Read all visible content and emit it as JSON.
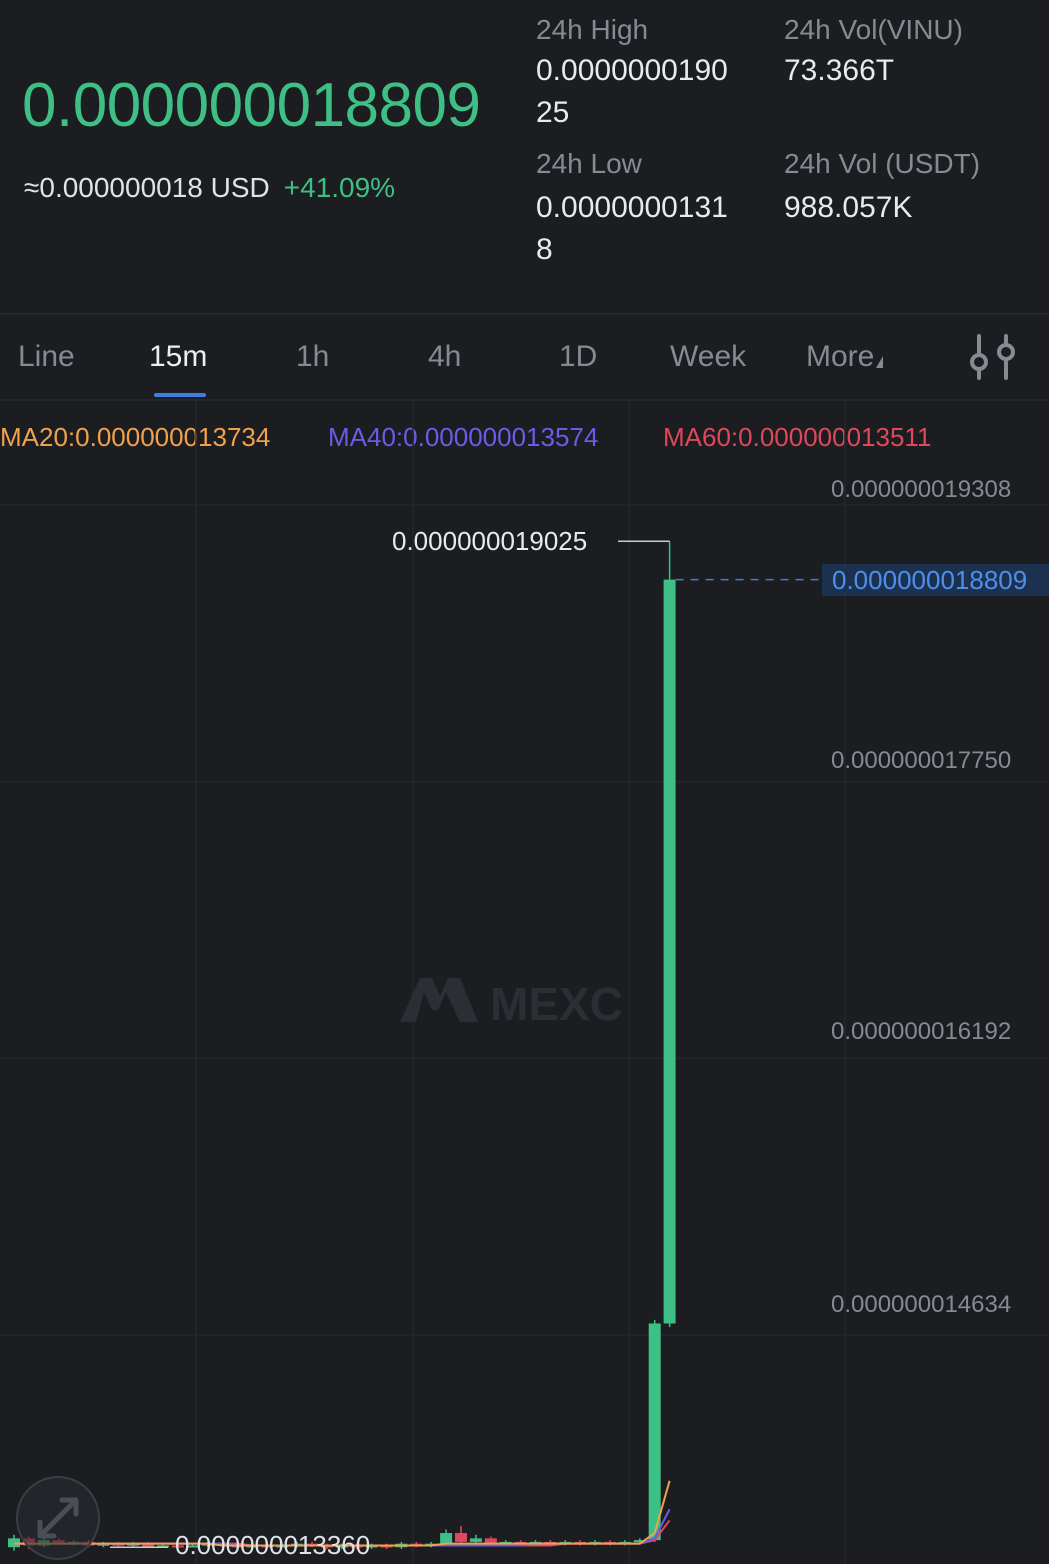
{
  "ticker": {
    "price": "0.000000018809",
    "usd_approx": "≈0.000000018 USD",
    "change_pct": "+41.09%",
    "high_label": "24h High",
    "high_value_line1": "0.0000000190",
    "high_value_line2": "25",
    "low_label": "24h Low",
    "low_value_line1": "0.0000000131",
    "low_value_line2": "8",
    "vol_base_label": "24h Vol(VINU)",
    "vol_base_value": "73.366T",
    "vol_quote_label": "24h Vol (USDT)",
    "vol_quote_value": "988.057K"
  },
  "tabs": [
    {
      "label": "Line",
      "active": false
    },
    {
      "label": "15m",
      "active": true
    },
    {
      "label": "1h",
      "active": false
    },
    {
      "label": "4h",
      "active": false
    },
    {
      "label": "1D",
      "active": false
    },
    {
      "label": "Week",
      "active": false
    },
    {
      "label": "More",
      "active": false
    }
  ],
  "indicators": {
    "ma20": "MA20:0.000000013734",
    "ma40": "MA40:0.000000013574",
    "ma60": "MA60:0.000000013511"
  },
  "colors": {
    "up": "#3ebf86",
    "down": "#e0475c",
    "ma20": "#f0a24a",
    "ma40": "#6a5ce8",
    "ma60": "#e0475c",
    "accent": "#3f7ee0"
  },
  "watermark": "MEXC",
  "chart_data": {
    "type": "candlestick",
    "interval": "15m",
    "y_axis_labels": [
      "0.000000019308",
      "0.000000017750",
      "0.000000016192",
      "0.000000014634"
    ],
    "y_axis_values": [
      1.9308e-08,
      1.775e-08,
      1.6192e-08,
      1.4634e-08
    ],
    "last_price_label": "0.000000018809",
    "last_price": 1.8809e-08,
    "high_marker_label": "0.000000019025",
    "high_marker": 1.9025e-08,
    "low_marker_label": "0.000000013360",
    "low_marker": 1.336e-08,
    "candles": [
      {
        "open": 1.336e-08,
        "close": 1.341e-08,
        "high": 1.343e-08,
        "low": 1.334e-08
      },
      {
        "open": 1.341e-08,
        "close": 1.337e-08,
        "high": 1.342e-08,
        "low": 1.335e-08
      },
      {
        "open": 1.337e-08,
        "close": 1.34e-08,
        "high": 1.341e-08,
        "low": 1.336e-08
      },
      {
        "open": 1.34e-08,
        "close": 1.338e-08,
        "high": 1.341e-08,
        "low": 1.337e-08
      },
      {
        "open": 1.338e-08,
        "close": 1.339e-08,
        "high": 1.34e-08,
        "low": 1.337e-08
      },
      {
        "open": 1.339e-08,
        "close": 1.337e-08,
        "high": 1.34e-08,
        "low": 1.336e-08
      },
      {
        "open": 1.337e-08,
        "close": 1.338e-08,
        "high": 1.339e-08,
        "low": 1.336e-08
      },
      {
        "open": 1.338e-08,
        "close": 1.337e-08,
        "high": 1.339e-08,
        "low": 1.336e-08
      },
      {
        "open": 1.337e-08,
        "close": 1.338e-08,
        "high": 1.339e-08,
        "low": 1.336e-08
      },
      {
        "open": 1.338e-08,
        "close": 1.336e-08,
        "high": 1.339e-08,
        "low": 1.336e-08
      },
      {
        "open": 1.336e-08,
        "close": 1.337e-08,
        "high": 1.338e-08,
        "low": 1.336e-08
      },
      {
        "open": 1.337e-08,
        "close": 1.336e-08,
        "high": 1.338e-08,
        "low": 1.336e-08
      },
      {
        "open": 1.336e-08,
        "close": 1.337e-08,
        "high": 1.338e-08,
        "low": 1.336e-08
      },
      {
        "open": 1.337e-08,
        "close": 1.338e-08,
        "high": 1.339e-08,
        "low": 1.336e-08
      },
      {
        "open": 1.338e-08,
        "close": 1.337e-08,
        "high": 1.339e-08,
        "low": 1.336e-08
      },
      {
        "open": 1.337e-08,
        "close": 1.336e-08,
        "high": 1.338e-08,
        "low": 1.336e-08
      },
      {
        "open": 1.336e-08,
        "close": 1.337e-08,
        "high": 1.338e-08,
        "low": 1.336e-08
      },
      {
        "open": 1.337e-08,
        "close": 1.336e-08,
        "high": 1.338e-08,
        "low": 1.336e-08
      },
      {
        "open": 1.336e-08,
        "close": 1.337e-08,
        "high": 1.338e-08,
        "low": 1.336e-08
      },
      {
        "open": 1.337e-08,
        "close": 1.338e-08,
        "high": 1.339e-08,
        "low": 1.336e-08
      },
      {
        "open": 1.338e-08,
        "close": 1.337e-08,
        "high": 1.339e-08,
        "low": 1.336e-08
      },
      {
        "open": 1.337e-08,
        "close": 1.336e-08,
        "high": 1.338e-08,
        "low": 1.335e-08
      },
      {
        "open": 1.336e-08,
        "close": 1.337e-08,
        "high": 1.338e-08,
        "low": 1.335e-08
      },
      {
        "open": 1.337e-08,
        "close": 1.336e-08,
        "high": 1.338e-08,
        "low": 1.335e-08
      },
      {
        "open": 1.336e-08,
        "close": 1.337e-08,
        "high": 1.338e-08,
        "low": 1.335e-08
      },
      {
        "open": 1.337e-08,
        "close": 1.336e-08,
        "high": 1.338e-08,
        "low": 1.335e-08
      },
      {
        "open": 1.336e-08,
        "close": 1.338e-08,
        "high": 1.339e-08,
        "low": 1.335e-08
      },
      {
        "open": 1.338e-08,
        "close": 1.337e-08,
        "high": 1.339e-08,
        "low": 1.336e-08
      },
      {
        "open": 1.337e-08,
        "close": 1.338e-08,
        "high": 1.339e-08,
        "low": 1.336e-08
      },
      {
        "open": 1.338e-08,
        "close": 1.344e-08,
        "high": 1.346e-08,
        "low": 1.337e-08
      },
      {
        "open": 1.344e-08,
        "close": 1.339e-08,
        "high": 1.348e-08,
        "low": 1.338e-08
      },
      {
        "open": 1.339e-08,
        "close": 1.341e-08,
        "high": 1.343e-08,
        "low": 1.338e-08
      },
      {
        "open": 1.341e-08,
        "close": 1.338e-08,
        "high": 1.342e-08,
        "low": 1.337e-08
      },
      {
        "open": 1.338e-08,
        "close": 1.339e-08,
        "high": 1.34e-08,
        "low": 1.337e-08
      },
      {
        "open": 1.339e-08,
        "close": 1.338e-08,
        "high": 1.34e-08,
        "low": 1.337e-08
      },
      {
        "open": 1.338e-08,
        "close": 1.339e-08,
        "high": 1.34e-08,
        "low": 1.337e-08
      },
      {
        "open": 1.339e-08,
        "close": 1.338e-08,
        "high": 1.34e-08,
        "low": 1.337e-08
      },
      {
        "open": 1.338e-08,
        "close": 1.339e-08,
        "high": 1.34e-08,
        "low": 1.337e-08
      },
      {
        "open": 1.339e-08,
        "close": 1.338e-08,
        "high": 1.34e-08,
        "low": 1.337e-08
      },
      {
        "open": 1.338e-08,
        "close": 1.339e-08,
        "high": 1.34e-08,
        "low": 1.337e-08
      },
      {
        "open": 1.339e-08,
        "close": 1.338e-08,
        "high": 1.34e-08,
        "low": 1.337e-08
      },
      {
        "open": 1.338e-08,
        "close": 1.339e-08,
        "high": 1.34e-08,
        "low": 1.337e-08
      },
      {
        "open": 1.339e-08,
        "close": 1.34e-08,
        "high": 1.341e-08,
        "low": 1.338e-08
      },
      {
        "open": 1.34e-08,
        "close": 1.462e-08,
        "high": 1.464e-08,
        "low": 1.339e-08
      },
      {
        "open": 1.462e-08,
        "close": 1.8809e-08,
        "high": 1.9025e-08,
        "low": 1.46e-08
      }
    ],
    "ma20": [
      1.338e-08,
      1.338e-08,
      1.338e-08,
      1.338e-08,
      1.338e-08,
      1.338e-08,
      1.338e-08,
      1.338e-08,
      1.338e-08,
      1.338e-08,
      1.338e-08,
      1.338e-08,
      1.338e-08,
      1.338e-08,
      1.337e-08,
      1.337e-08,
      1.337e-08,
      1.337e-08,
      1.337e-08,
      1.337e-08,
      1.337e-08,
      1.337e-08,
      1.337e-08,
      1.337e-08,
      1.337e-08,
      1.337e-08,
      1.337e-08,
      1.337e-08,
      1.337e-08,
      1.338e-08,
      1.338e-08,
      1.338e-08,
      1.338e-08,
      1.338e-08,
      1.338e-08,
      1.338e-08,
      1.338e-08,
      1.338e-08,
      1.338e-08,
      1.338e-08,
      1.338e-08,
      1.338e-08,
      1.338e-08,
      1.344e-08,
      1.3734e-08
    ],
    "ma40": [
      1.338e-08,
      1.338e-08,
      1.338e-08,
      1.338e-08,
      1.338e-08,
      1.338e-08,
      1.338e-08,
      1.338e-08,
      1.338e-08,
      1.338e-08,
      1.338e-08,
      1.338e-08,
      1.338e-08,
      1.338e-08,
      1.338e-08,
      1.337e-08,
      1.337e-08,
      1.337e-08,
      1.337e-08,
      1.337e-08,
      1.337e-08,
      1.337e-08,
      1.337e-08,
      1.337e-08,
      1.337e-08,
      1.337e-08,
      1.337e-08,
      1.337e-08,
      1.337e-08,
      1.337e-08,
      1.337e-08,
      1.337e-08,
      1.337e-08,
      1.337e-08,
      1.337e-08,
      1.338e-08,
      1.338e-08,
      1.338e-08,
      1.338e-08,
      1.338e-08,
      1.338e-08,
      1.338e-08,
      1.338e-08,
      1.341e-08,
      1.3574e-08
    ],
    "ma60": [
      1.338e-08,
      1.338e-08,
      1.338e-08,
      1.338e-08,
      1.338e-08,
      1.338e-08,
      1.338e-08,
      1.338e-08,
      1.338e-08,
      1.338e-08,
      1.338e-08,
      1.338e-08,
      1.338e-08,
      1.338e-08,
      1.338e-08,
      1.338e-08,
      1.337e-08,
      1.337e-08,
      1.337e-08,
      1.337e-08,
      1.337e-08,
      1.337e-08,
      1.337e-08,
      1.337e-08,
      1.337e-08,
      1.337e-08,
      1.337e-08,
      1.337e-08,
      1.337e-08,
      1.337e-08,
      1.337e-08,
      1.337e-08,
      1.337e-08,
      1.337e-08,
      1.337e-08,
      1.337e-08,
      1.337e-08,
      1.338e-08,
      1.338e-08,
      1.338e-08,
      1.338e-08,
      1.338e-08,
      1.338e-08,
      1.34e-08,
      1.3511e-08
    ]
  }
}
